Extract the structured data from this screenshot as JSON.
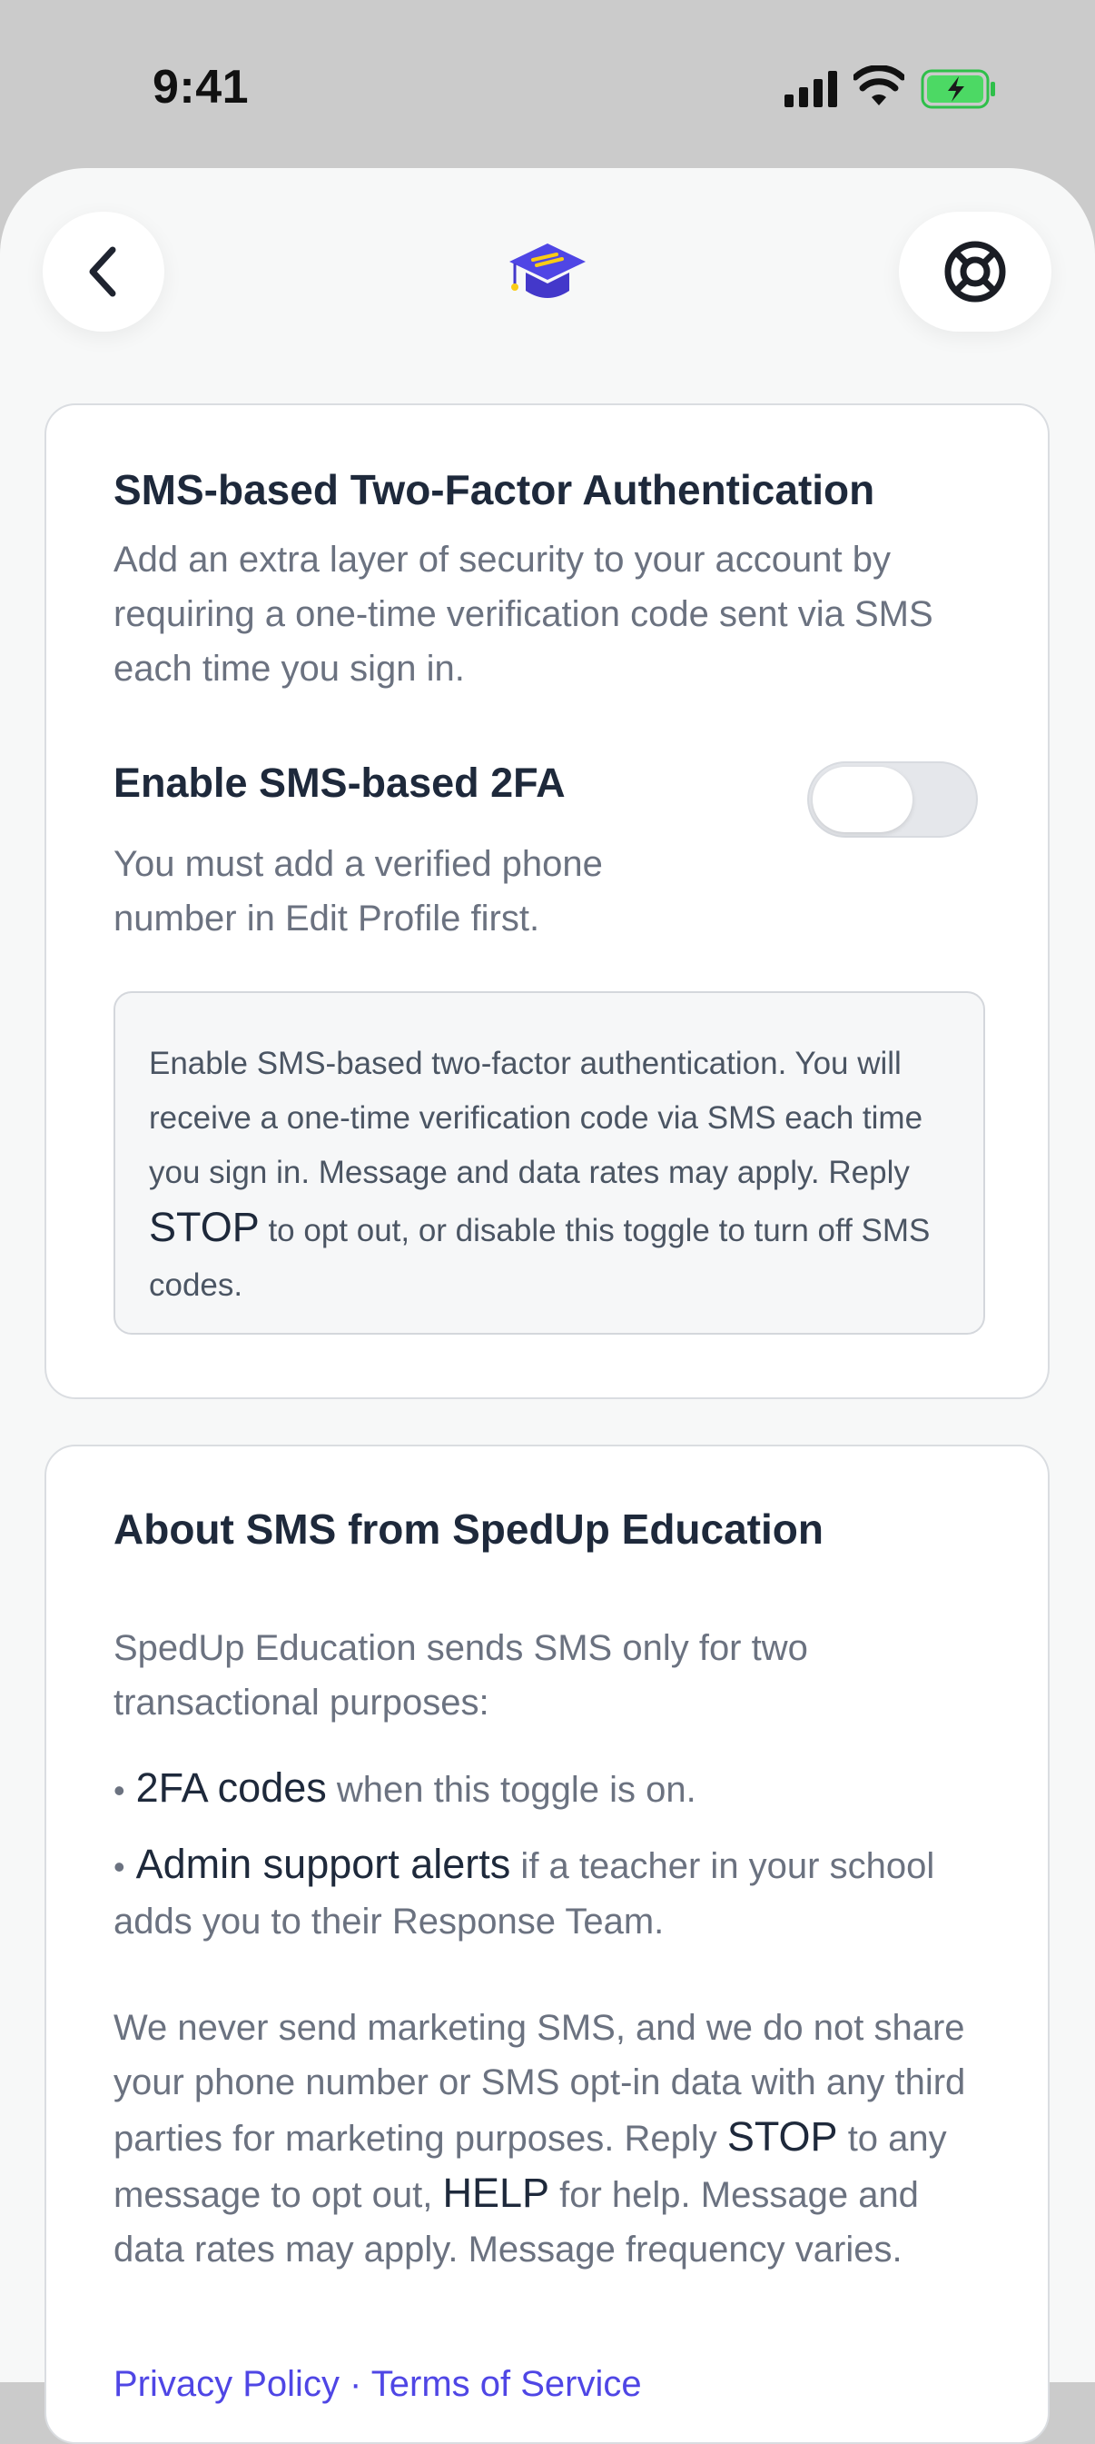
{
  "status": {
    "time": "9:41"
  },
  "card1": {
    "title": "SMS-based Two-Factor Authentication",
    "description": "Add an extra layer of security to your account by requiring a one-time verification code sent via SMS each time you sign in.",
    "toggle_label": "Enable SMS-based 2FA",
    "toggle_help": "You must add a verified phone number in Edit Profile first.",
    "toggle_on": false,
    "notice_pre": "Enable SMS-based two-factor authentication. You will receive a one-time verification code via SMS each time you sign in. Message and data rates may apply. Reply ",
    "notice_stop": "STOP",
    "notice_post": " to opt out, or disable this toggle to turn off SMS codes."
  },
  "card2": {
    "title": "About SMS from SpedUp Education",
    "intro": "SpedUp Education sends SMS only for two transactional purposes:",
    "bullet_dot": "•",
    "bullet1_strong": "2FA codes",
    "bullet1_rest": " when this toggle is on.",
    "bullet2_strong": "Admin support alerts",
    "bullet2_rest": " if a teacher in your school adds you to their Response Team.",
    "para_a": "We never send marketing SMS, and we do not share your phone number or SMS opt-in data with any third parties for marketing purposes. Reply ",
    "para_stop": "STOP",
    "para_b": " to any message to opt out, ",
    "para_help": "HELP",
    "para_c": " for help. Message and data rates may apply. Message frequency varies.",
    "links_text": "Privacy Policy · Terms of Service"
  },
  "colors": {
    "accent": "#4f46e5",
    "logo_stripe": "#facc15"
  }
}
